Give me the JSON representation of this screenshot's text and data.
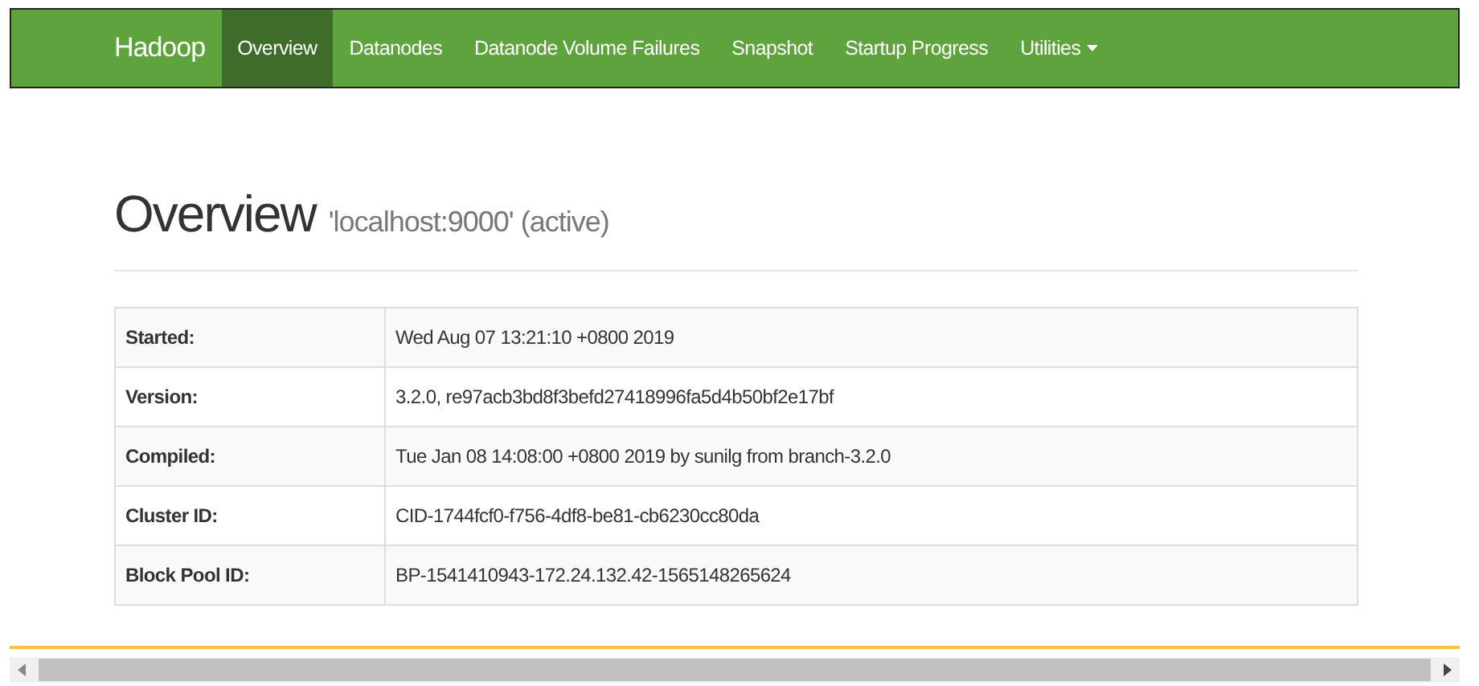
{
  "navbar": {
    "brand": "Hadoop",
    "items": [
      {
        "label": "Overview",
        "selected": true,
        "dropdown": false
      },
      {
        "label": "Datanodes",
        "selected": false,
        "dropdown": false
      },
      {
        "label": "Datanode Volume Failures",
        "selected": false,
        "dropdown": false
      },
      {
        "label": "Snapshot",
        "selected": false,
        "dropdown": false
      },
      {
        "label": "Startup Progress",
        "selected": false,
        "dropdown": false
      },
      {
        "label": "Utilities",
        "selected": false,
        "dropdown": true
      }
    ]
  },
  "page": {
    "title": "Overview",
    "subtitle": "'localhost:9000' (active)"
  },
  "table": {
    "rows": [
      {
        "label": "Started:",
        "value": "Wed Aug 07 13:21:10 +0800 2019"
      },
      {
        "label": "Version:",
        "value": "3.2.0, re97acb3bd8f3befd27418996fa5d4b50bf2e17bf"
      },
      {
        "label": "Compiled:",
        "value": "Tue Jan 08 14:08:00 +0800 2019 by sunilg from branch-3.2.0"
      },
      {
        "label": "Cluster ID:",
        "value": "CID-1744fcf0-f756-4df8-be81-cb6230cc80da"
      },
      {
        "label": "Block Pool ID:",
        "value": "BP-1541410943-172.24.132.42-1565148265624"
      }
    ]
  }
}
